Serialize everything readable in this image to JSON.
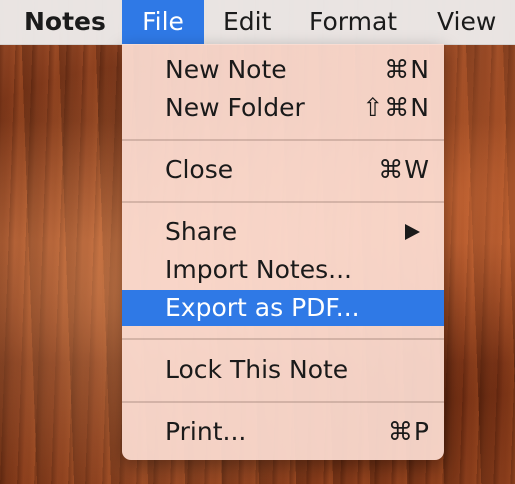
{
  "menubar": {
    "app": "Notes",
    "items": [
      "File",
      "Edit",
      "Format",
      "View"
    ]
  },
  "file_menu": {
    "items": [
      {
        "label": "New Note",
        "shortcut": "⌘N"
      },
      {
        "label": "New Folder",
        "shortcut": "⇧⌘N"
      },
      {
        "label": "Close",
        "shortcut": "⌘W"
      },
      {
        "label": "Share",
        "submenu": true,
        "shortcut": ""
      },
      {
        "label": "Import Notes...",
        "shortcut": ""
      },
      {
        "label": "Export as PDF...",
        "shortcut": "",
        "highlighted": true
      },
      {
        "label": "Lock This Note",
        "shortcut": ""
      },
      {
        "label": "Print...",
        "shortcut": "⌘P"
      }
    ]
  },
  "colors": {
    "accent": "#2f79e6",
    "menubar_bg": "#ece9e8",
    "menu_bg": "#fcddd2"
  }
}
